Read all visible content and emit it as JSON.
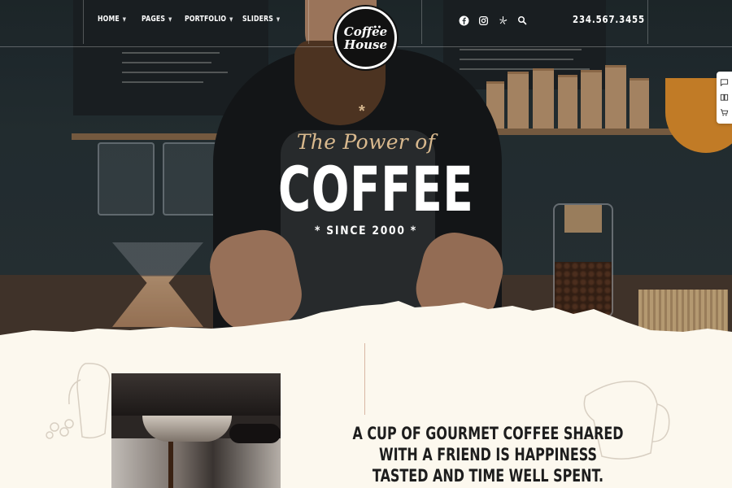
{
  "nav": {
    "items": [
      {
        "label": "HOME"
      },
      {
        "label": "PAGES"
      },
      {
        "label": "PORTFOLIO"
      },
      {
        "label": "SLIDERS"
      }
    ]
  },
  "logo": {
    "line1": "Coffee",
    "line2": "House"
  },
  "socials": [
    {
      "icon": "facebook-icon"
    },
    {
      "icon": "instagram-icon"
    },
    {
      "icon": "yelp-icon"
    },
    {
      "icon": "search-icon"
    }
  ],
  "phone": "234.567.3455",
  "side_tools": [
    {
      "icon": "chat-icon"
    },
    {
      "icon": "book-icon"
    },
    {
      "icon": "cart-icon"
    }
  ],
  "hero": {
    "asterisk": "*",
    "script_title": "The Power of",
    "title": "COFFEE",
    "subtitle": "* SINCE 2000 *"
  },
  "intro": {
    "quote": "A cup of gourmet coffee shared with a friend is happiness tasted and time well spent."
  },
  "colors": {
    "accent_gold": "#d9b98e",
    "cream_background": "#fcf8ee",
    "dark": "#141718"
  }
}
